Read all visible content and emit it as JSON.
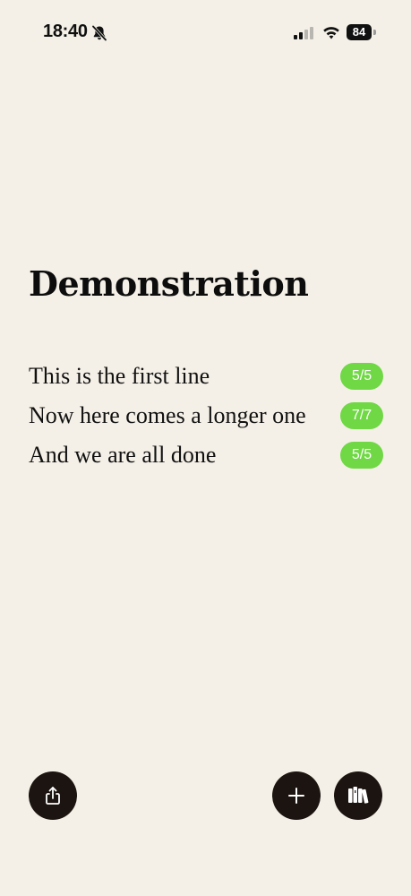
{
  "status_bar": {
    "time": "18:40",
    "battery_level": "84",
    "icons": [
      "bell-off-icon",
      "cellular-signal-icon",
      "wifi-icon",
      "battery-icon"
    ]
  },
  "page": {
    "title": "Demonstration"
  },
  "lines": [
    {
      "text": "This is the first line",
      "score": "5/5"
    },
    {
      "text": "Now here comes a longer one",
      "score": "7/7"
    },
    {
      "text": "And we are all done",
      "score": "5/5"
    }
  ],
  "actions": {
    "share_icon": "share-icon",
    "add_icon": "plus-icon",
    "library_icon": "books-icon"
  },
  "colors": {
    "background": "#f4f0e7",
    "badge": "#6fd844",
    "button": "#1c1410"
  }
}
